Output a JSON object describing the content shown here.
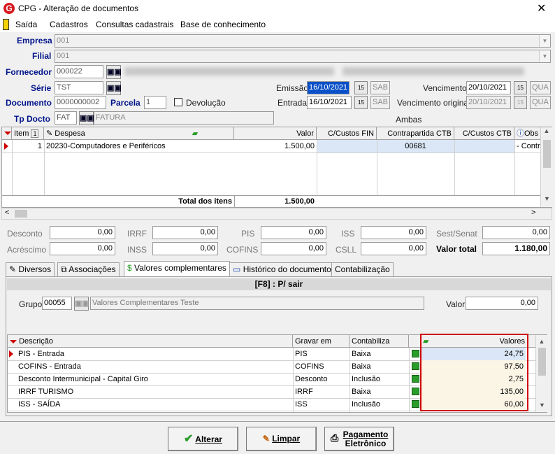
{
  "window": {
    "title": "CPG - Alteração de documentos",
    "close": "✕",
    "app_icon": "G"
  },
  "menu": [
    "Saída",
    "Cadastros",
    "Consultas cadastrais",
    "Base de conhecimento"
  ],
  "form": {
    "empresa_label": "Empresa",
    "empresa": "001",
    "filial_label": "Filial",
    "filial": "001",
    "fornecedor_label": "Fornecedor",
    "fornecedor": "000022",
    "serie_label": "Série",
    "serie": "TST",
    "documento_label": "Documento",
    "documento": "0000000002",
    "parcela_label": "Parcela",
    "parcela": "1",
    "devolucao_label": "Devolução",
    "tpdocto_label": "Tp Docto",
    "tpdocto": "FAT",
    "tpdocto_desc": "FATURA",
    "emissao_label": "Emissão",
    "emissao": "16/10/2021",
    "emissao_day": "SAB",
    "entrada_label": "Entrada",
    "entrada": "16/10/2021",
    "entrada_day": "SAB",
    "vencimento_label": "Vencimento",
    "vencimento": "20/10/2021",
    "vencimento_day": "QUA",
    "venc_original_label": "Vencimento original",
    "venc_original": "20/10/2021",
    "venc_original_day": "QUA",
    "ambas": "Ambas",
    "calendar_icon_text": "15",
    "binoc_text": "▣▣"
  },
  "items_grid": {
    "headers": {
      "item": "Item",
      "sort": "1",
      "despesa": "Despesa",
      "valor": "Valor",
      "ccfin": "C/Custos FIN",
      "contrapartida": "Contrapartida CTB",
      "ccctb": "C/Custos CTB",
      "obs": "Obs"
    },
    "rows": [
      {
        "item": "1",
        "despesa": "20230-Computadores e Periféricos",
        "valor": "1.500,00",
        "contrapartida": "00681",
        "obs": "- Contra"
      }
    ],
    "total_label": "Total dos itens",
    "total": "1.500,00"
  },
  "totals": {
    "desconto_label": "Desconto",
    "desconto": "0,00",
    "irrf_label": "IRRF",
    "irrf": "0,00",
    "pis_label": "PIS",
    "pis": "0,00",
    "iss_label": "ISS",
    "iss": "0,00",
    "sestsenat_label": "Sest/Senat",
    "sestsenat": "0,00",
    "acrescimo_label": "Acréscimo",
    "acrescimo": "0,00",
    "inss_label": "INSS",
    "inss": "0,00",
    "cofins_label": "COFINS",
    "cofins": "0,00",
    "csll_label": "CSLL",
    "csll": "0,00",
    "valor_total_label": "Valor total",
    "valor_total": "1.180,00"
  },
  "tabs": [
    "Diversos",
    "Associações",
    "Valores complementares",
    "Histórico do documento",
    "Contabilização"
  ],
  "panel": {
    "header": "[F8] : P/ sair",
    "grupo_label": "Grupo",
    "grupo": "00055",
    "grupo_desc": "Valores Complementares Teste",
    "valor_label": "Valor",
    "valor": "0,00"
  },
  "comp_grid": {
    "headers": {
      "descricao": "Descrição",
      "gravar": "Gravar em",
      "contabiliza": "Contabiliza",
      "valores": "Valores"
    },
    "rows": [
      {
        "descricao": "PIS - Entrada",
        "gravar": "PIS",
        "contabiliza": "Baixa",
        "valor": "24,75"
      },
      {
        "descricao": "COFINS - Entrada",
        "gravar": "COFINS",
        "contabiliza": "Baixa",
        "valor": "97,50"
      },
      {
        "descricao": "Desconto Intermunicipal - Capital Giro",
        "gravar": "Desconto",
        "contabiliza": "Inclusão",
        "valor": "2,75"
      },
      {
        "descricao": "IRRF TURISMO",
        "gravar": "IRRF",
        "contabiliza": "Baixa",
        "valor": "135,00"
      },
      {
        "descricao": "ISS - SAÍDA",
        "gravar": "ISS",
        "contabiliza": "Inclusão",
        "valor": "60,00"
      }
    ]
  },
  "buttons": {
    "alterar": "Alterar",
    "limpar": "Limpar",
    "pagamento_1": "Pagamento",
    "pagamento_2": "Eletrônico"
  },
  "colors": {
    "accent_red": "#d00000",
    "label_blue": "#00138a",
    "selection_blue": "#0a50c8",
    "highlight_red_box": "#d00000"
  }
}
